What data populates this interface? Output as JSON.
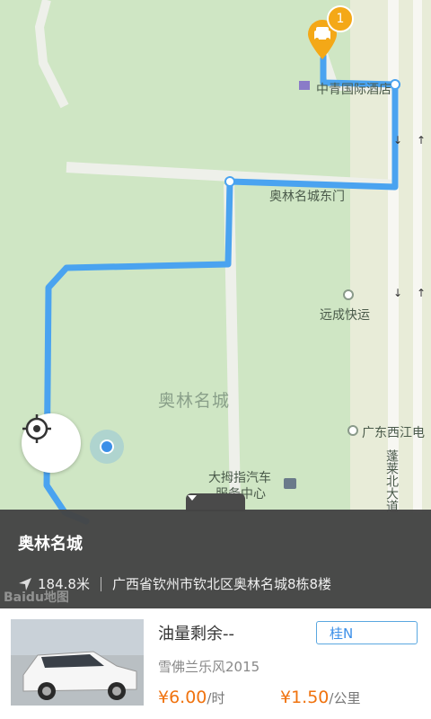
{
  "map": {
    "labels": {
      "hotel": "中青国际酒店",
      "east_gate": "奥林名城东门",
      "express": "远成快运",
      "area": "奥林名城",
      "guangdong": "广东西江电",
      "service_center_1": "大拇指汽车",
      "service_center_2": "服务中心",
      "road": "蓬莱北大道"
    },
    "car_count": "1",
    "attribution": "Baidu地图"
  },
  "info": {
    "title": "奥林名城",
    "distance": "184.8米",
    "address": "广西省钦州市钦北区奥林名城8栋8楼"
  },
  "car": {
    "fuel": "油量剩余--",
    "plate": "桂N",
    "model": "雪佛兰乐风2015",
    "price_hour": "¥6.00",
    "price_hour_unit": "/时",
    "price_km": "¥1.50",
    "price_km_unit": "/公里"
  },
  "colors": {
    "route": "#4aa3f0",
    "map_green": "#cfe6c4",
    "panel": "#444444",
    "accent": "#f0730f",
    "pin": "#f4a817"
  }
}
